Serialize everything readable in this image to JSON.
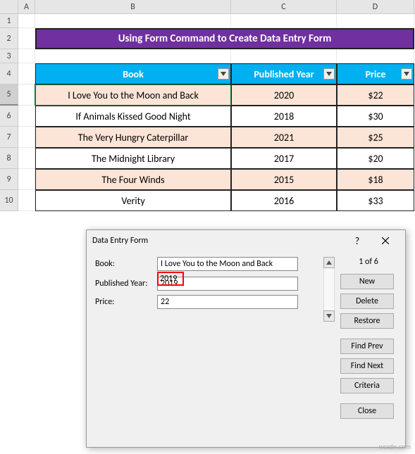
{
  "columns": [
    "A",
    "B",
    "C",
    "D"
  ],
  "row_numbers": [
    "1",
    "2",
    "3",
    "4",
    "5",
    "6",
    "7",
    "8",
    "9",
    "10"
  ],
  "title": "Using Form Command to Create Data Entry Form",
  "table": {
    "headers": [
      "Book",
      "Published Year",
      "Price"
    ],
    "rows": [
      {
        "book": "I Love You to the Moon and Back",
        "year": "2020",
        "price": "$22"
      },
      {
        "book": "If Animals Kissed Good Night",
        "year": "2018",
        "price": "$30"
      },
      {
        "book": "The Very Hungry Caterpillar",
        "year": "2021",
        "price": "$25"
      },
      {
        "book": "The Midnight Library",
        "year": "2017",
        "price": "$20"
      },
      {
        "book": "The Four Winds",
        "year": "2015",
        "price": "$18"
      },
      {
        "book": "Verity",
        "year": "2016",
        "price": "$33"
      }
    ]
  },
  "chart_data": {
    "type": "table",
    "columns": [
      "Book",
      "Published Year",
      "Price"
    ],
    "rows": [
      [
        "I Love You to the Moon and Back",
        2020,
        22
      ],
      [
        "If Animals Kissed Good Night",
        2018,
        30
      ],
      [
        "The Very Hungry Caterpillar",
        2021,
        25
      ],
      [
        "The Midnight Library",
        2017,
        20
      ],
      [
        "The Four Winds",
        2015,
        18
      ],
      [
        "Verity",
        2016,
        33
      ]
    ]
  },
  "dialog": {
    "title": "Data Entry Form",
    "help": "?",
    "labels": {
      "book": "Book:",
      "year": "Published Year:",
      "price": "Price:"
    },
    "values": {
      "book": "I Love You to the Moon and Back",
      "year": "2019",
      "price": "22"
    },
    "counter": "1 of 6",
    "buttons": {
      "new": "New",
      "delete": "Delete",
      "restore": "Restore",
      "find_prev": "Find Prev",
      "find_next": "Find Next",
      "criteria": "Criteria",
      "close": "Close"
    }
  },
  "watermark": "wsxdn.com"
}
